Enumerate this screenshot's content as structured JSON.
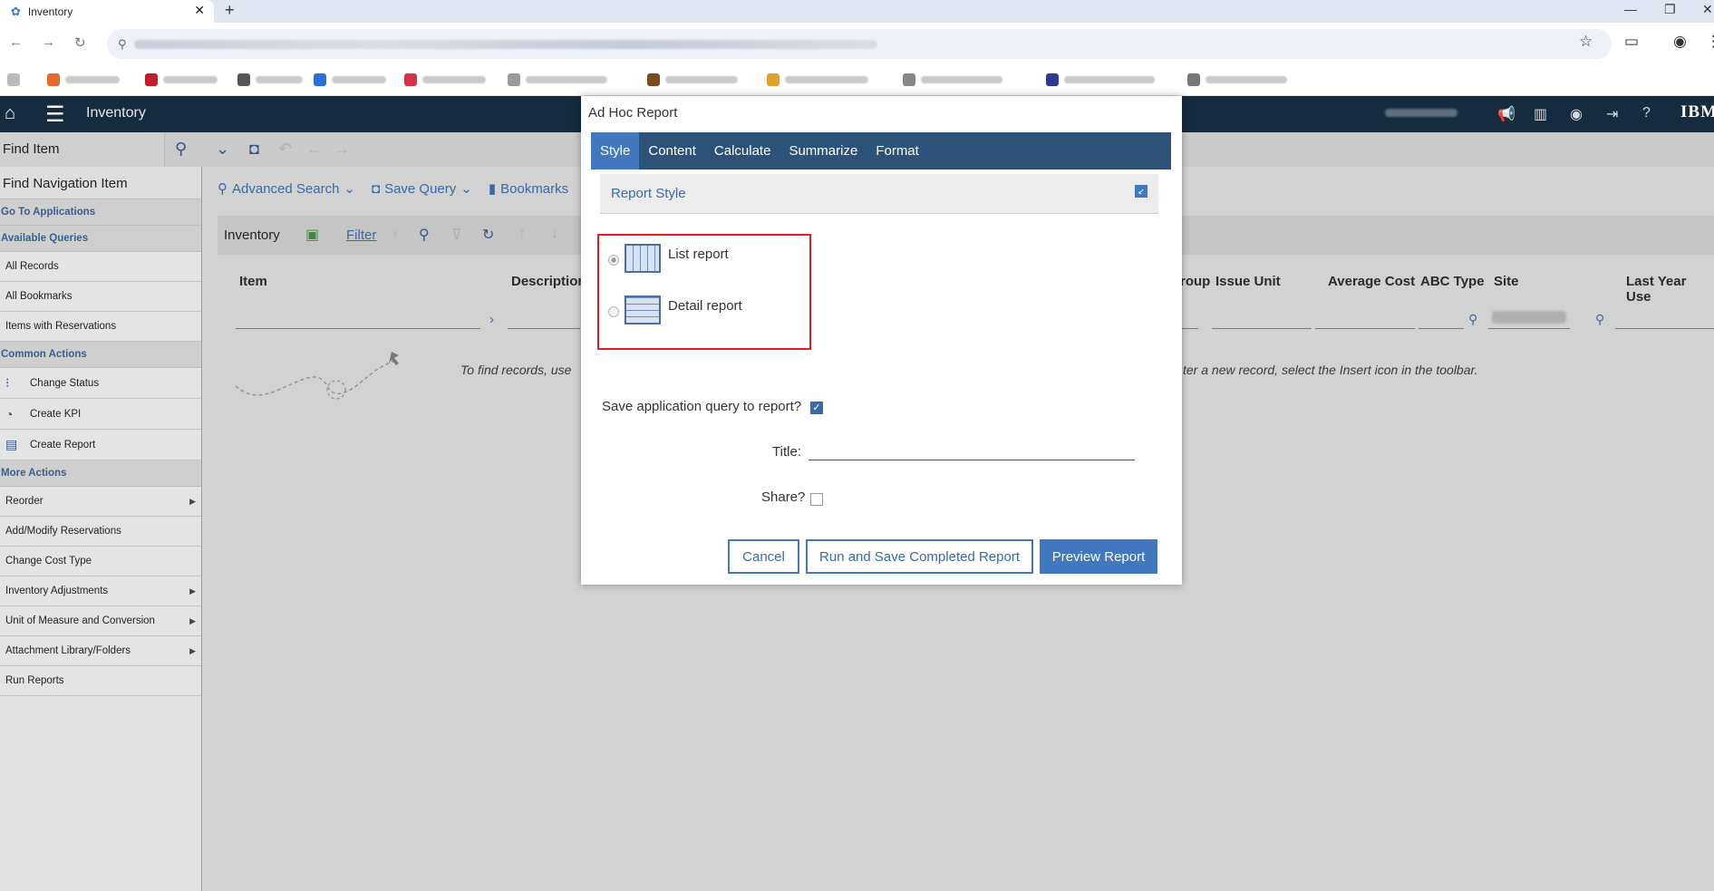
{
  "browser": {
    "tab_title": "Inventory",
    "new_tab": "+",
    "bookmarks_count": 10
  },
  "app": {
    "title": "Inventory",
    "brand": "IBM"
  },
  "toolbar": {
    "find_item": "Find Item"
  },
  "sidebar": {
    "find_nav": "Find Navigation Item",
    "go_to_apps": "Go To Applications",
    "available_queries": "Available Queries",
    "queries": [
      "All Records",
      "All Bookmarks",
      "Items with Reservations"
    ],
    "common_actions": "Common Actions",
    "common": [
      "Change Status",
      "Create KPI",
      "Create Report"
    ],
    "more_actions": "More Actions",
    "more": [
      "Reorder",
      "Add/Modify Reservations",
      "Change Cost Type",
      "Inventory Adjustments",
      "Unit of Measure and Conversion",
      "Attachment Library/Folders",
      "Run Reports"
    ]
  },
  "main": {
    "advanced_search": "Advanced Search",
    "save_query": "Save Query",
    "bookmarks": "Bookmarks",
    "list_label": "Inventory",
    "filter": "Filter",
    "columns": [
      "Item",
      "Description",
      "roup",
      "Issue Unit",
      "Average Cost",
      "ABC Type",
      "Site",
      "Last Year Use"
    ],
    "empty_left": "To find records, use",
    "empty_right": "ter a new record, select the Insert icon in the toolbar."
  },
  "dialog": {
    "title": "Ad Hoc Report",
    "tabs": [
      "Style",
      "Content",
      "Calculate",
      "Summarize",
      "Format"
    ],
    "section": "Report Style",
    "list_report": "List report",
    "detail_report": "Detail report",
    "save_query_label": "Save application query to report?",
    "title_label": "Title:",
    "share_label": "Share?",
    "cancel": "Cancel",
    "run_save": "Run and Save Completed Report",
    "preview": "Preview Report"
  }
}
